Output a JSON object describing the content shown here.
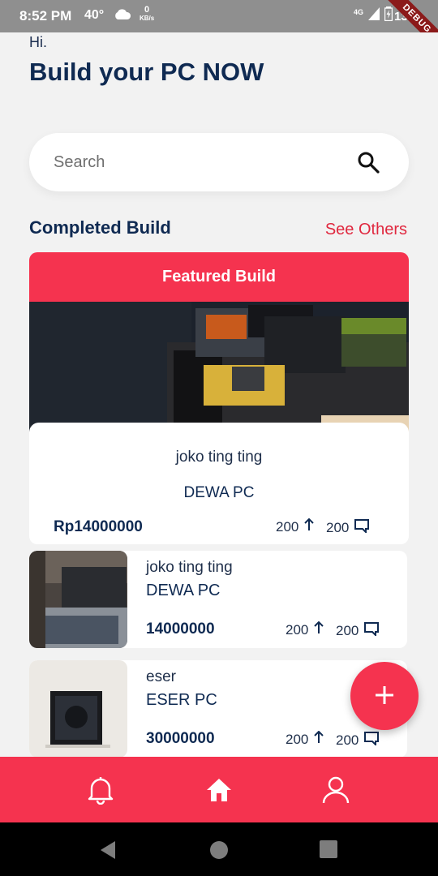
{
  "status_bar": {
    "time": "8:52 PM",
    "temperature": "40°",
    "net_speed_value": "0",
    "net_speed_unit": "KB/s",
    "network": "4G",
    "battery": "13%",
    "debug_banner": "DEBUG"
  },
  "header": {
    "greeting": "Hi.",
    "headline": "Build your PC NOW"
  },
  "search": {
    "placeholder": "Search"
  },
  "section": {
    "title": "Completed Build",
    "see_others": "See Others"
  },
  "featured": {
    "label": "Featured Build",
    "builder": "joko ting ting",
    "build_name": "DEWA PC",
    "price": "Rp14000000",
    "upvotes": "200",
    "comments": "200"
  },
  "builds": [
    {
      "builder": "joko ting ting",
      "build_name": "DEWA PC",
      "price": "14000000",
      "upvotes": "200",
      "comments": "200"
    },
    {
      "builder": "eser",
      "build_name": "ESER PC",
      "price": "30000000",
      "upvotes": "200",
      "comments": "200"
    }
  ],
  "nav": {
    "items": [
      "bell-icon",
      "home-icon",
      "person-icon"
    ],
    "active": "home-icon"
  },
  "colors": {
    "accent": "#f5334f",
    "primary_text": "#0f2a52",
    "link": "#e0283f"
  }
}
